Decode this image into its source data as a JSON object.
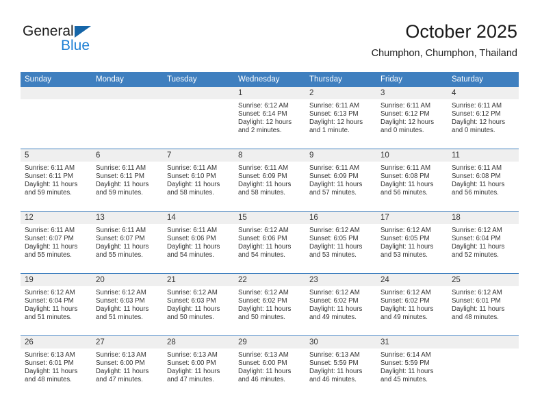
{
  "brand": {
    "name_top": "General",
    "name_bottom": "Blue",
    "triangle_color": "#1565a8",
    "blue_color": "#1c7fd4"
  },
  "header": {
    "month_title": "October 2025",
    "location": "Chumphon, Chumphon, Thailand"
  },
  "theme": {
    "header_bg": "#3f7fbf",
    "daynum_bg": "#efefef",
    "row_divider": "#3f7fbf",
    "text": "#333333"
  },
  "weekday_headers": [
    "Sunday",
    "Monday",
    "Tuesday",
    "Wednesday",
    "Thursday",
    "Friday",
    "Saturday"
  ],
  "labels": {
    "sunrise_prefix": "Sunrise:",
    "sunset_prefix": "Sunset:",
    "daylight_prefix": "Daylight:"
  },
  "weeks": [
    [
      {
        "day": "",
        "empty": true
      },
      {
        "day": "",
        "empty": true
      },
      {
        "day": "",
        "empty": true
      },
      {
        "day": "1",
        "sunrise": "Sunrise: 6:12 AM",
        "sunset": "Sunset: 6:14 PM",
        "daylight": "Daylight: 12 hours and 2 minutes."
      },
      {
        "day": "2",
        "sunrise": "Sunrise: 6:11 AM",
        "sunset": "Sunset: 6:13 PM",
        "daylight": "Daylight: 12 hours and 1 minute."
      },
      {
        "day": "3",
        "sunrise": "Sunrise: 6:11 AM",
        "sunset": "Sunset: 6:12 PM",
        "daylight": "Daylight: 12 hours and 0 minutes."
      },
      {
        "day": "4",
        "sunrise": "Sunrise: 6:11 AM",
        "sunset": "Sunset: 6:12 PM",
        "daylight": "Daylight: 12 hours and 0 minutes."
      }
    ],
    [
      {
        "day": "5",
        "sunrise": "Sunrise: 6:11 AM",
        "sunset": "Sunset: 6:11 PM",
        "daylight": "Daylight: 11 hours and 59 minutes."
      },
      {
        "day": "6",
        "sunrise": "Sunrise: 6:11 AM",
        "sunset": "Sunset: 6:11 PM",
        "daylight": "Daylight: 11 hours and 59 minutes."
      },
      {
        "day": "7",
        "sunrise": "Sunrise: 6:11 AM",
        "sunset": "Sunset: 6:10 PM",
        "daylight": "Daylight: 11 hours and 58 minutes."
      },
      {
        "day": "8",
        "sunrise": "Sunrise: 6:11 AM",
        "sunset": "Sunset: 6:09 PM",
        "daylight": "Daylight: 11 hours and 58 minutes."
      },
      {
        "day": "9",
        "sunrise": "Sunrise: 6:11 AM",
        "sunset": "Sunset: 6:09 PM",
        "daylight": "Daylight: 11 hours and 57 minutes."
      },
      {
        "day": "10",
        "sunrise": "Sunrise: 6:11 AM",
        "sunset": "Sunset: 6:08 PM",
        "daylight": "Daylight: 11 hours and 56 minutes."
      },
      {
        "day": "11",
        "sunrise": "Sunrise: 6:11 AM",
        "sunset": "Sunset: 6:08 PM",
        "daylight": "Daylight: 11 hours and 56 minutes."
      }
    ],
    [
      {
        "day": "12",
        "sunrise": "Sunrise: 6:11 AM",
        "sunset": "Sunset: 6:07 PM",
        "daylight": "Daylight: 11 hours and 55 minutes."
      },
      {
        "day": "13",
        "sunrise": "Sunrise: 6:11 AM",
        "sunset": "Sunset: 6:07 PM",
        "daylight": "Daylight: 11 hours and 55 minutes."
      },
      {
        "day": "14",
        "sunrise": "Sunrise: 6:11 AM",
        "sunset": "Sunset: 6:06 PM",
        "daylight": "Daylight: 11 hours and 54 minutes."
      },
      {
        "day": "15",
        "sunrise": "Sunrise: 6:12 AM",
        "sunset": "Sunset: 6:06 PM",
        "daylight": "Daylight: 11 hours and 54 minutes."
      },
      {
        "day": "16",
        "sunrise": "Sunrise: 6:12 AM",
        "sunset": "Sunset: 6:05 PM",
        "daylight": "Daylight: 11 hours and 53 minutes."
      },
      {
        "day": "17",
        "sunrise": "Sunrise: 6:12 AM",
        "sunset": "Sunset: 6:05 PM",
        "daylight": "Daylight: 11 hours and 53 minutes."
      },
      {
        "day": "18",
        "sunrise": "Sunrise: 6:12 AM",
        "sunset": "Sunset: 6:04 PM",
        "daylight": "Daylight: 11 hours and 52 minutes."
      }
    ],
    [
      {
        "day": "19",
        "sunrise": "Sunrise: 6:12 AM",
        "sunset": "Sunset: 6:04 PM",
        "daylight": "Daylight: 11 hours and 51 minutes."
      },
      {
        "day": "20",
        "sunrise": "Sunrise: 6:12 AM",
        "sunset": "Sunset: 6:03 PM",
        "daylight": "Daylight: 11 hours and 51 minutes."
      },
      {
        "day": "21",
        "sunrise": "Sunrise: 6:12 AM",
        "sunset": "Sunset: 6:03 PM",
        "daylight": "Daylight: 11 hours and 50 minutes."
      },
      {
        "day": "22",
        "sunrise": "Sunrise: 6:12 AM",
        "sunset": "Sunset: 6:02 PM",
        "daylight": "Daylight: 11 hours and 50 minutes."
      },
      {
        "day": "23",
        "sunrise": "Sunrise: 6:12 AM",
        "sunset": "Sunset: 6:02 PM",
        "daylight": "Daylight: 11 hours and 49 minutes."
      },
      {
        "day": "24",
        "sunrise": "Sunrise: 6:12 AM",
        "sunset": "Sunset: 6:02 PM",
        "daylight": "Daylight: 11 hours and 49 minutes."
      },
      {
        "day": "25",
        "sunrise": "Sunrise: 6:12 AM",
        "sunset": "Sunset: 6:01 PM",
        "daylight": "Daylight: 11 hours and 48 minutes."
      }
    ],
    [
      {
        "day": "26",
        "sunrise": "Sunrise: 6:13 AM",
        "sunset": "Sunset: 6:01 PM",
        "daylight": "Daylight: 11 hours and 48 minutes."
      },
      {
        "day": "27",
        "sunrise": "Sunrise: 6:13 AM",
        "sunset": "Sunset: 6:00 PM",
        "daylight": "Daylight: 11 hours and 47 minutes."
      },
      {
        "day": "28",
        "sunrise": "Sunrise: 6:13 AM",
        "sunset": "Sunset: 6:00 PM",
        "daylight": "Daylight: 11 hours and 47 minutes."
      },
      {
        "day": "29",
        "sunrise": "Sunrise: 6:13 AM",
        "sunset": "Sunset: 6:00 PM",
        "daylight": "Daylight: 11 hours and 46 minutes."
      },
      {
        "day": "30",
        "sunrise": "Sunrise: 6:13 AM",
        "sunset": "Sunset: 5:59 PM",
        "daylight": "Daylight: 11 hours and 46 minutes."
      },
      {
        "day": "31",
        "sunrise": "Sunrise: 6:14 AM",
        "sunset": "Sunset: 5:59 PM",
        "daylight": "Daylight: 11 hours and 45 minutes."
      },
      {
        "day": "",
        "empty": true
      }
    ]
  ]
}
